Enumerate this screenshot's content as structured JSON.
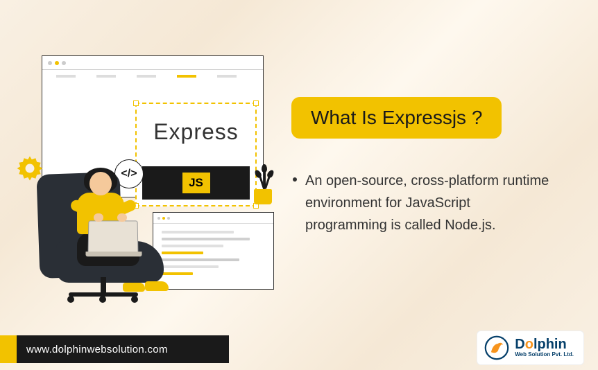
{
  "illustration": {
    "express_label": "Express",
    "js_badge": "JS",
    "code_bracket": "</>"
  },
  "content": {
    "heading": "What Is Expressjs ?",
    "bullet_text": "An open-source, cross-platform runtime environment for JavaScript programming is called Node.js."
  },
  "footer": {
    "url": "www.dolphinwebsolution.com",
    "logo_prefix": "D",
    "logo_o": "o",
    "logo_suffix": "lphin",
    "logo_tagline": "Web Solution Pvt. Ltd."
  },
  "colors": {
    "accent": "#f2c200",
    "dark": "#1a1a1a",
    "brand_blue": "#06406b",
    "brand_orange": "#f7941d"
  }
}
